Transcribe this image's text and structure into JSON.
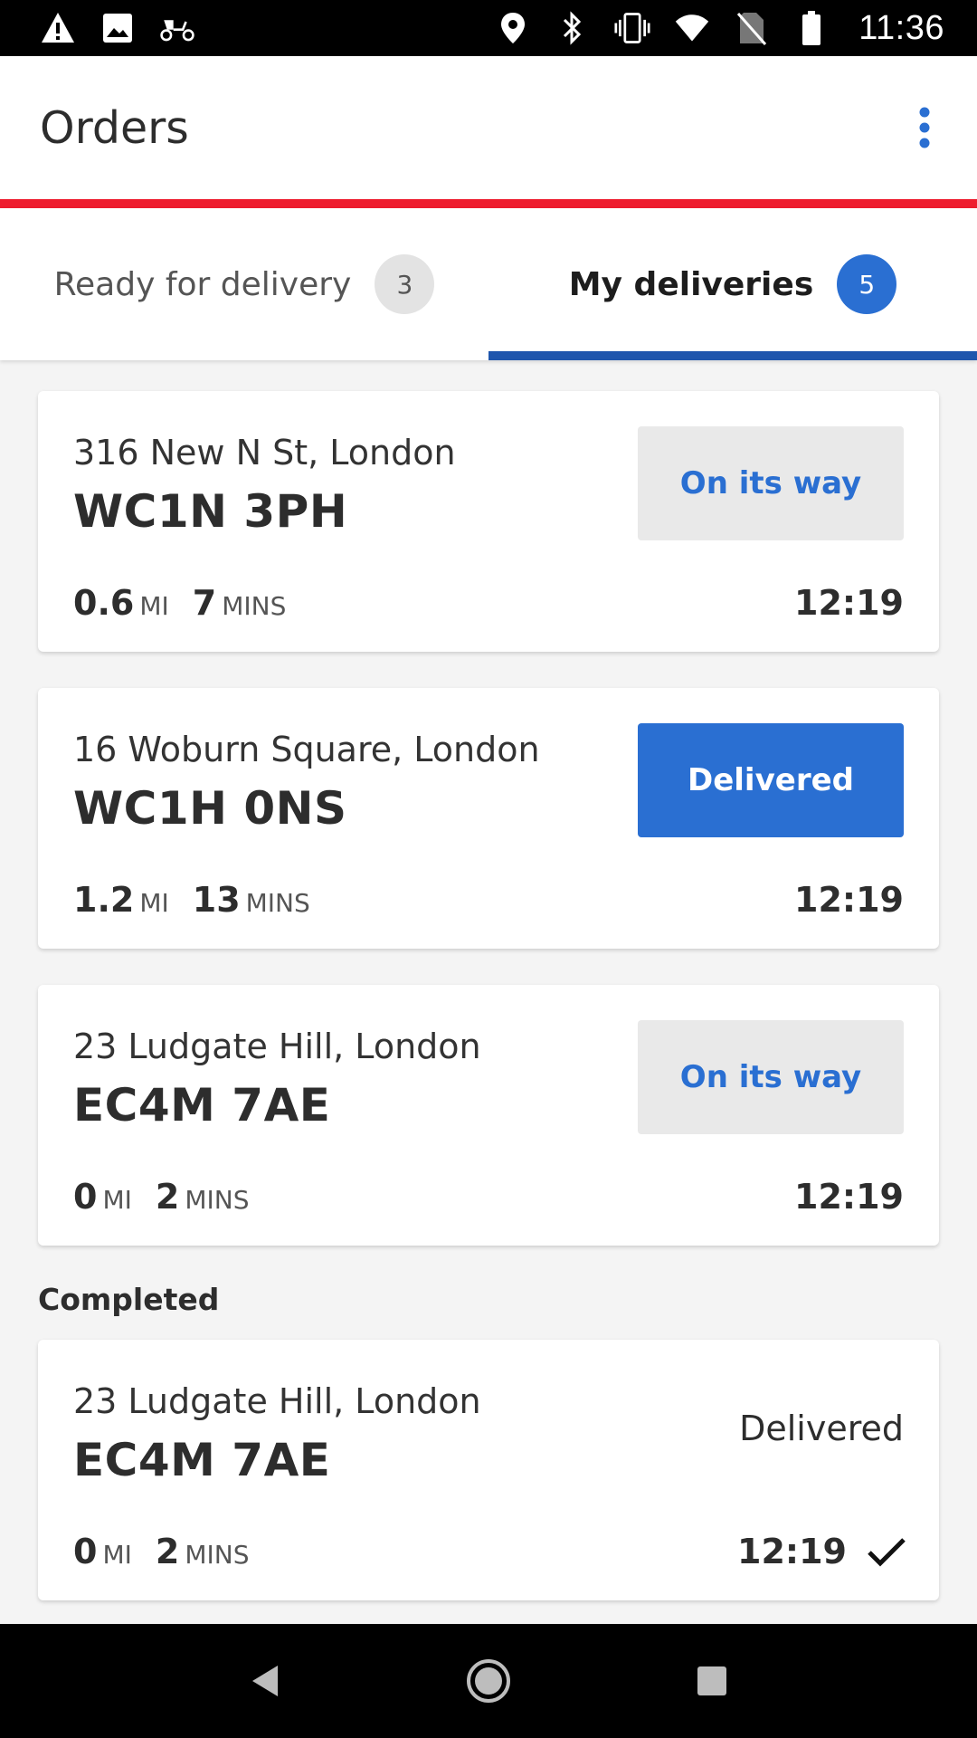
{
  "status_bar": {
    "time": "11:36",
    "left_icons": [
      "warning-icon",
      "image-icon",
      "scooter-icon"
    ],
    "right_icons": [
      "location-icon",
      "bluetooth-icon",
      "vibrate-icon",
      "wifi-icon",
      "no-sim-icon",
      "battery-icon"
    ]
  },
  "app_bar": {
    "title": "Orders",
    "menu_icon": "more-vert-icon",
    "accent_color": "#ee1c2e"
  },
  "tabs": [
    {
      "label": "Ready for delivery",
      "count": "3",
      "active": false
    },
    {
      "label": "My deliveries",
      "count": "5",
      "active": true
    }
  ],
  "deliveries": [
    {
      "street": "316 New N St, London",
      "postcode": "WC1N 3PH",
      "distance": "0.6",
      "distance_unit": "MI",
      "duration": "7",
      "duration_unit": "MINS",
      "time": "12:19",
      "status": "On its way"
    },
    {
      "street": "16 Woburn Square, London",
      "postcode": "WC1H 0NS",
      "distance": "1.2",
      "distance_unit": "MI",
      "duration": "13",
      "duration_unit": "MINS",
      "time": "12:19",
      "status": "Delivered"
    },
    {
      "street": "23 Ludgate Hill, London",
      "postcode": "EC4M 7AE",
      "distance": "0",
      "distance_unit": "MI",
      "duration": "2",
      "duration_unit": "MINS",
      "time": "12:19",
      "status": "On its way"
    }
  ],
  "completed": {
    "title": "Completed",
    "items": [
      {
        "street": "23 Ludgate Hill, London",
        "postcode": "EC4M 7AE",
        "distance": "0",
        "distance_unit": "MI",
        "duration": "2",
        "duration_unit": "MINS",
        "time": "12:19",
        "status": "Delivered"
      }
    ]
  },
  "colors": {
    "primary_blue": "#2a6fd2",
    "tab_indicator": "#1f56ad",
    "neutral_button": "#e9e9e9"
  },
  "nav_bar": {
    "buttons": [
      "back-icon",
      "home-icon",
      "recents-icon"
    ]
  }
}
